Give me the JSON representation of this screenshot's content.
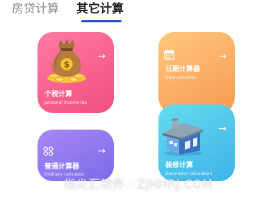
{
  "tabs": [
    {
      "label": "房贷计算",
      "active": false
    },
    {
      "label": "其它计算",
      "active": true
    }
  ],
  "accent_color": "#2b47c8",
  "cards": {
    "tax": {
      "title": "个税计算",
      "subtitle": "personal income tax",
      "arrow": "→",
      "icon": "money-bag-icon",
      "colors": [
        "#ff7aa2",
        "#f04f7f"
      ]
    },
    "date": {
      "title": "日期计算器",
      "subtitle": "Date calculator",
      "arrow": "→",
      "icon": "calendar-icon",
      "colors": [
        "#ffc77d",
        "#f79a52"
      ]
    },
    "ordinary": {
      "title": "普通计算器",
      "subtitle": "Ordinary calculator",
      "arrow": "→",
      "icon": "calculator-keys-icon",
      "colors": [
        "#a787f5",
        "#7b6be8"
      ]
    },
    "decoration": {
      "title": "装修计算",
      "subtitle": "Decoration calculation",
      "arrow": "→",
      "icon": "house-icon",
      "colors": [
        "#66dcee",
        "#3eb2e8"
      ]
    }
  },
  "watermark": "指尖汇软件 · ZJHHRJ.COM"
}
